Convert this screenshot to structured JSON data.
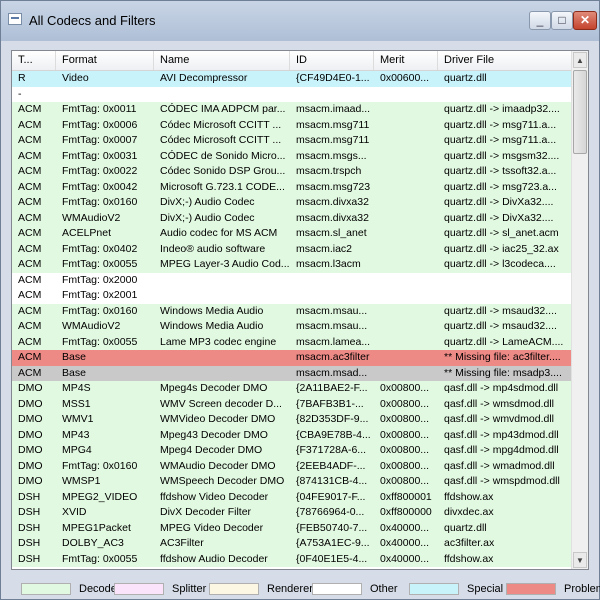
{
  "window": {
    "title": "All Codecs and Filters",
    "controls": {
      "minimize": "_",
      "maximize": "□",
      "close": "✕"
    }
  },
  "columns": [
    "T...",
    "Format",
    "Name",
    "ID",
    "Merit",
    "Driver File"
  ],
  "colors": {
    "Decoder": "#e2f9e1",
    "Splitter": "#fbe3fb",
    "Renderer": "#fbf7e2",
    "Other": "#ffffff",
    "Special": "#c8f3fb",
    "Problem": "#ee8a86",
    "Selected": "#c9c9c9"
  },
  "rows": [
    {
      "cells": [
        "R",
        "Video",
        "AVI Decompressor",
        "{CF49D4E0-1...",
        "0x00600...",
        "quartz.dll"
      ],
      "kind": "Special"
    },
    {
      "cells": [
        "-",
        "",
        "",
        "",
        "",
        ""
      ],
      "kind": "Other"
    },
    {
      "cells": [
        "ACM",
        "FmtTag: 0x0011",
        "CÓDEC IMA ADPCM par...",
        "msacm.imaad...",
        "",
        "quartz.dll -> imaadp32...."
      ],
      "kind": "Decoder"
    },
    {
      "cells": [
        "ACM",
        "FmtTag: 0x0006",
        "Códec Microsoft CCITT ...",
        "msacm.msg711",
        "",
        "quartz.dll -> msg711.a..."
      ],
      "kind": "Decoder"
    },
    {
      "cells": [
        "ACM",
        "FmtTag: 0x0007",
        "Códec Microsoft CCITT ...",
        "msacm.msg711",
        "",
        "quartz.dll -> msg711.a..."
      ],
      "kind": "Decoder"
    },
    {
      "cells": [
        "ACM",
        "FmtTag: 0x0031",
        "CÓDEC de Sonido Micro...",
        "msacm.msgs...",
        "",
        "quartz.dll -> msgsm32...."
      ],
      "kind": "Decoder"
    },
    {
      "cells": [
        "ACM",
        "FmtTag: 0x0022",
        "Códec Sonido DSP Grou...",
        "msacm.trspch",
        "",
        "quartz.dll -> tssoft32.a..."
      ],
      "kind": "Decoder"
    },
    {
      "cells": [
        "ACM",
        "FmtTag: 0x0042",
        "Microsoft G.723.1 CODE...",
        "msacm.msg723",
        "",
        "quartz.dll -> msg723.a..."
      ],
      "kind": "Decoder"
    },
    {
      "cells": [
        "ACM",
        "FmtTag: 0x0160",
        "DivX;-) Audio Codec",
        "msacm.divxa32",
        "",
        "quartz.dll -> DivXa32...."
      ],
      "kind": "Decoder"
    },
    {
      "cells": [
        "ACM",
        "WMAudioV2",
        "DivX;-) Audio Codec",
        "msacm.divxa32",
        "",
        "quartz.dll -> DivXa32...."
      ],
      "kind": "Decoder"
    },
    {
      "cells": [
        "ACM",
        "ACELPnet",
        "Audio codec for MS ACM",
        "msacm.sl_anet",
        "",
        "quartz.dll -> sl_anet.acm"
      ],
      "kind": "Decoder"
    },
    {
      "cells": [
        "ACM",
        "FmtTag: 0x0402",
        "Indeo® audio software",
        "msacm.iac2",
        "",
        "quartz.dll -> iac25_32.ax"
      ],
      "kind": "Decoder"
    },
    {
      "cells": [
        "ACM",
        "FmtTag: 0x0055",
        "MPEG Layer-3 Audio Cod...",
        "msacm.l3acm",
        "",
        "quartz.dll -> l3codeca...."
      ],
      "kind": "Decoder"
    },
    {
      "cells": [
        "ACM",
        "FmtTag: 0x2000",
        "",
        "",
        "",
        ""
      ],
      "kind": "Other"
    },
    {
      "cells": [
        "ACM",
        "FmtTag: 0x2001",
        "",
        "",
        "",
        ""
      ],
      "kind": "Other"
    },
    {
      "cells": [
        "ACM",
        "FmtTag: 0x0160",
        "Windows Media Audio",
        "msacm.msau...",
        "",
        "quartz.dll -> msaud32...."
      ],
      "kind": "Decoder"
    },
    {
      "cells": [
        "ACM",
        "WMAudioV2",
        "Windows Media Audio",
        "msacm.msau...",
        "",
        "quartz.dll -> msaud32...."
      ],
      "kind": "Decoder"
    },
    {
      "cells": [
        "ACM",
        "FmtTag: 0x0055",
        "Lame MP3 codec engine",
        "msacm.lamea...",
        "",
        "quartz.dll -> LameACM...."
      ],
      "kind": "Decoder"
    },
    {
      "cells": [
        "ACM",
        "Base",
        "",
        "msacm.ac3filter",
        "",
        "** Missing file: ac3filter...."
      ],
      "kind": "Problem"
    },
    {
      "cells": [
        "ACM",
        "Base",
        "",
        "msacm.msad...",
        "",
        "** Missing file: msadp3...."
      ],
      "kind": "Selected"
    },
    {
      "cells": [
        "DMO",
        "MP4S",
        "Mpeg4s Decoder DMO",
        "{2A11BAE2-F...",
        "0x00800...",
        "qasf.dll -> mp4sdmod.dll"
      ],
      "kind": "Decoder"
    },
    {
      "cells": [
        "DMO",
        "MSS1",
        "WMV Screen decoder D...",
        "{7BAFB3B1-...",
        "0x00800...",
        "qasf.dll -> wmsdmod.dll"
      ],
      "kind": "Decoder"
    },
    {
      "cells": [
        "DMO",
        "WMV1",
        "WMVideo Decoder DMO",
        "{82D353DF-9...",
        "0x00800...",
        "qasf.dll -> wmvdmod.dll"
      ],
      "kind": "Decoder"
    },
    {
      "cells": [
        "DMO",
        "MP43",
        "Mpeg43 Decoder DMO",
        "{CBA9E78B-4...",
        "0x00800...",
        "qasf.dll -> mp43dmod.dll"
      ],
      "kind": "Decoder"
    },
    {
      "cells": [
        "DMO",
        "MPG4",
        "Mpeg4 Decoder DMO",
        "{F371728A-6...",
        "0x00800...",
        "qasf.dll -> mpg4dmod.dll"
      ],
      "kind": "Decoder"
    },
    {
      "cells": [
        "DMO",
        "FmtTag: 0x0160",
        "WMAudio Decoder DMO",
        "{2EEB4ADF-...",
        "0x00800...",
        "qasf.dll -> wmadmod.dll"
      ],
      "kind": "Decoder"
    },
    {
      "cells": [
        "DMO",
        "WMSP1",
        "WMSpeech Decoder DMO",
        "{874131CB-4...",
        "0x00800...",
        "qasf.dll -> wmspdmod.dll"
      ],
      "kind": "Decoder"
    },
    {
      "cells": [
        "DSH",
        "MPEG2_VIDEO",
        "ffdshow Video Decoder",
        "{04FE9017-F...",
        "0xff800001",
        "ffdshow.ax"
      ],
      "kind": "Decoder"
    },
    {
      "cells": [
        "DSH",
        "XVID",
        "DivX Decoder Filter",
        "{78766964-0...",
        "0xff800000",
        "divxdec.ax"
      ],
      "kind": "Decoder"
    },
    {
      "cells": [
        "DSH",
        "MPEG1Packet",
        "MPEG Video Decoder",
        "{FEB50740-7...",
        "0x40000...",
        "quartz.dll"
      ],
      "kind": "Decoder"
    },
    {
      "cells": [
        "DSH",
        "DOLBY_AC3",
        "AC3Filter",
        "{A753A1EC-9...",
        "0x40000...",
        "ac3filter.ax"
      ],
      "kind": "Decoder"
    },
    {
      "cells": [
        "DSH",
        "FmtTag: 0x0055",
        "ffdshow Audio Decoder",
        "{0F40E1E5-4...",
        "0x40000...",
        "ffdshow.ax"
      ],
      "kind": "Decoder"
    }
  ],
  "scrollbar": {
    "up_arrow": "▲",
    "down_arrow": "▼"
  },
  "legend": [
    "Decoder",
    "Splitter",
    "Renderer",
    "Other",
    "Special",
    "Problem"
  ]
}
